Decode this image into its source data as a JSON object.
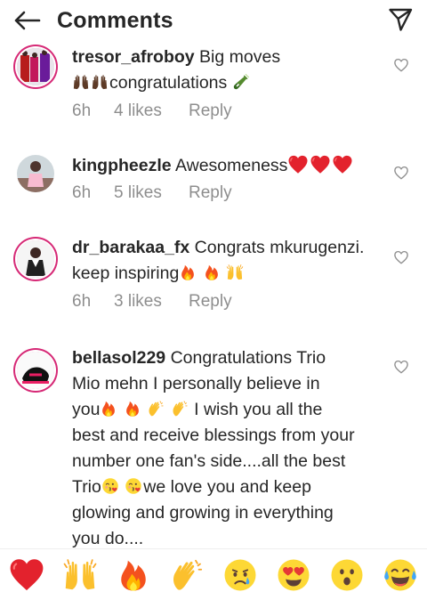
{
  "header": {
    "title": "Comments"
  },
  "comments": [
    {
      "username": "tresor_afroboy",
      "text_1": " Big moves",
      "text_2": "congratulations ",
      "time": "6h",
      "likes": "4 likes",
      "reply": "Reply"
    },
    {
      "username": "kingpheezle",
      "text_1": " Awesomeness",
      "time": "6h",
      "likes": "5 likes",
      "reply": "Reply"
    },
    {
      "username": "dr_barakaa_fx",
      "text_1": " Congrats mkurugenzi.",
      "text_2": "keep inspiring",
      "time": "6h",
      "likes": "3 likes",
      "reply": "Reply"
    },
    {
      "username": "bellasol229",
      "text_1": " Congratulations Trio",
      "text_2": "Mio mehn I personally believe in",
      "text_3a": "you",
      "text_3b": " I wish you all the",
      "text_4": "best and receive blessings from your",
      "text_5": "number one fan's side....all the best",
      "text_6a": "Trio",
      "text_6b": "we love you and keep",
      "text_7": "glowing and growing in everything",
      "text_8": "you do...."
    }
  ],
  "emoji_bar": [
    "red-heart",
    "raised-hands",
    "fire",
    "clapping-hands",
    "sad-tear-face",
    "heart-eyes-face",
    "surprised-face",
    "tears-of-joy-face"
  ],
  "colors": {
    "text": "#262626",
    "secondary": "#8e8e8e",
    "story_ring": "#d62976"
  }
}
